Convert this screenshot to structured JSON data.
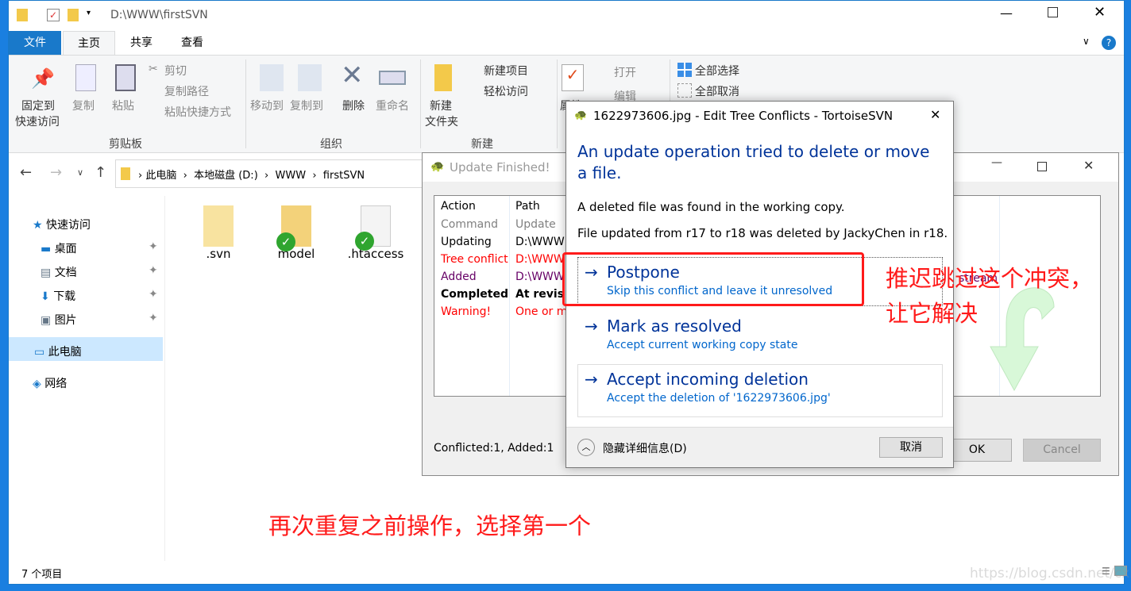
{
  "explorer": {
    "title": "D:\\WWW\\firstSVN",
    "tabs": [
      "文件",
      "主页",
      "共享",
      "查看"
    ],
    "ribbon": {
      "clipboard": {
        "pin": "固定到",
        "pin2": "快速访问",
        "copy": "复制",
        "paste": "粘贴",
        "cut": "剪切",
        "copy_path": "复制路径",
        "paste_shortcut": "粘贴快捷方式",
        "group": "剪贴板"
      },
      "organize": {
        "move_to": "移动到",
        "copy_to": "复制到",
        "delete": "删除",
        "rename": "重命名",
        "group": "组织"
      },
      "new": {
        "new_folder": "新建",
        "new_folder2": "文件夹",
        "new_item": "新建项目",
        "easy_access": "轻松访问",
        "group": "新建"
      },
      "open": {
        "properties": "属性",
        "open": "打开",
        "edit": "编辑"
      },
      "select": {
        "select_all": "全部选择",
        "select_none": "全部取消"
      }
    },
    "breadcrumb": [
      "此电脑",
      "本地磁盘 (D:)",
      "WWW",
      "firstSVN"
    ],
    "sidebar": [
      {
        "label": "快速访问"
      },
      {
        "label": "桌面"
      },
      {
        "label": "文档"
      },
      {
        "label": "下载"
      },
      {
        "label": "图片"
      },
      {
        "label": "此电脑"
      },
      {
        "label": "网络"
      }
    ],
    "files": [
      {
        "name": ".svn"
      },
      {
        "name": "model"
      },
      {
        "name": ".htaccess"
      }
    ],
    "status": "7 个项目"
  },
  "update_dialog": {
    "title": "Update Finished!",
    "headers": [
      "Action",
      "Path"
    ],
    "rows": [
      {
        "action": "Command",
        "path": "Update",
        "color": "#808080"
      },
      {
        "action": "Updating",
        "path": "D:\\WWW",
        "color": "#000000"
      },
      {
        "action": "Tree conflict",
        "path": "D:\\WWW",
        "color": "#ff0000"
      },
      {
        "action": "Added",
        "path": "D:\\WWW",
        "color": "#660066"
      },
      {
        "action": "Completed",
        "path": "At revis",
        "color": "#000000"
      },
      {
        "action": "Warning!",
        "path": "One or m",
        "color": "#ff0000"
      }
    ],
    "stream_text": "stream",
    "summary": "Conflicted:1, Added:1",
    "ok": "OK",
    "cancel": "Cancel"
  },
  "conflict_dialog": {
    "title": "1622973606.jpg - Edit Tree Conflicts - TortoiseSVN",
    "heading": "An update operation tried to delete or move a file.",
    "line1": "A deleted file was found in the working copy.",
    "line2": "File updated from r17 to r18 was deleted by JackyChen in r18.",
    "options": [
      {
        "title": "Postpone",
        "sub": "Skip this conflict and leave it unresolved"
      },
      {
        "title": "Mark as resolved",
        "sub": "Accept current working copy state"
      },
      {
        "title": "Accept incoming deletion",
        "sub": "Accept the deletion of '1622973606.jpg'"
      }
    ],
    "details": "隐藏详细信息(D)",
    "cancel": "取消"
  },
  "annotations": {
    "right1": "推迟跳过这个冲突，",
    "right2": "让它解决",
    "bottom": "再次重复之前操作，选择第一个"
  },
  "watermark": "https://blog.csdn.net/cxhblog",
  "colors": {
    "accent": "#0066cc",
    "annotation": "#ff1a1a"
  }
}
